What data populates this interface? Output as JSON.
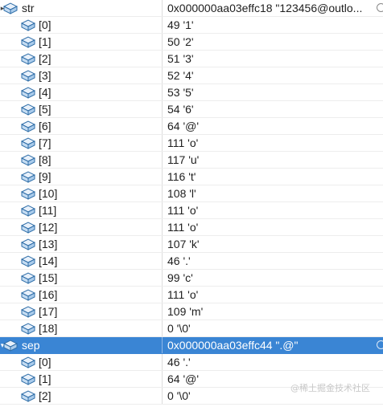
{
  "watch": {
    "rows": [
      {
        "name": "str",
        "value": "0x000000aa03effc18 \"123456@outlo...",
        "expander": "▸",
        "depth": 0
      },
      {
        "name": "[0]",
        "value": "49 '1'",
        "depth": 1
      },
      {
        "name": "[1]",
        "value": "50 '2'",
        "depth": 1
      },
      {
        "name": "[2]",
        "value": "51 '3'",
        "depth": 1
      },
      {
        "name": "[3]",
        "value": "52 '4'",
        "depth": 1
      },
      {
        "name": "[4]",
        "value": "53 '5'",
        "depth": 1
      },
      {
        "name": "[5]",
        "value": "54 '6'",
        "depth": 1
      },
      {
        "name": "[6]",
        "value": "64 '@'",
        "depth": 1
      },
      {
        "name": "[7]",
        "value": "111 'o'",
        "depth": 1
      },
      {
        "name": "[8]",
        "value": "117 'u'",
        "depth": 1
      },
      {
        "name": "[9]",
        "value": "116 't'",
        "depth": 1
      },
      {
        "name": "[10]",
        "value": "108 'l'",
        "depth": 1
      },
      {
        "name": "[11]",
        "value": "111 'o'",
        "depth": 1
      },
      {
        "name": "[12]",
        "value": "111 'o'",
        "depth": 1
      },
      {
        "name": "[13]",
        "value": "107 'k'",
        "depth": 1
      },
      {
        "name": "[14]",
        "value": "46 '.'",
        "depth": 1
      },
      {
        "name": "[15]",
        "value": "99 'c'",
        "depth": 1
      },
      {
        "name": "[16]",
        "value": "111 'o'",
        "depth": 1
      },
      {
        "name": "[17]",
        "value": "109 'm'",
        "depth": 1
      },
      {
        "name": "[18]",
        "value": "0 '\\0'",
        "depth": 1
      },
      {
        "name": "sep",
        "value": "0x000000aa03effc44 \".@\"",
        "expander": "▾",
        "depth": 0,
        "selected": true
      },
      {
        "name": "[0]",
        "value": "46 '.'",
        "depth": 1
      },
      {
        "name": "[1]",
        "value": "64 '@'",
        "depth": 1
      },
      {
        "name": "[2]",
        "value": "0 '\\0'",
        "depth": 1
      }
    ]
  },
  "watermark": "@稀土掘金技术社区",
  "colors": {
    "selection": "#3a85d4",
    "icon_fill": "#dbe9f6",
    "icon_stroke": "#2f6ea8"
  },
  "icons": {
    "object": "object-cube-icon",
    "magnifier": "magnifier-icon"
  }
}
